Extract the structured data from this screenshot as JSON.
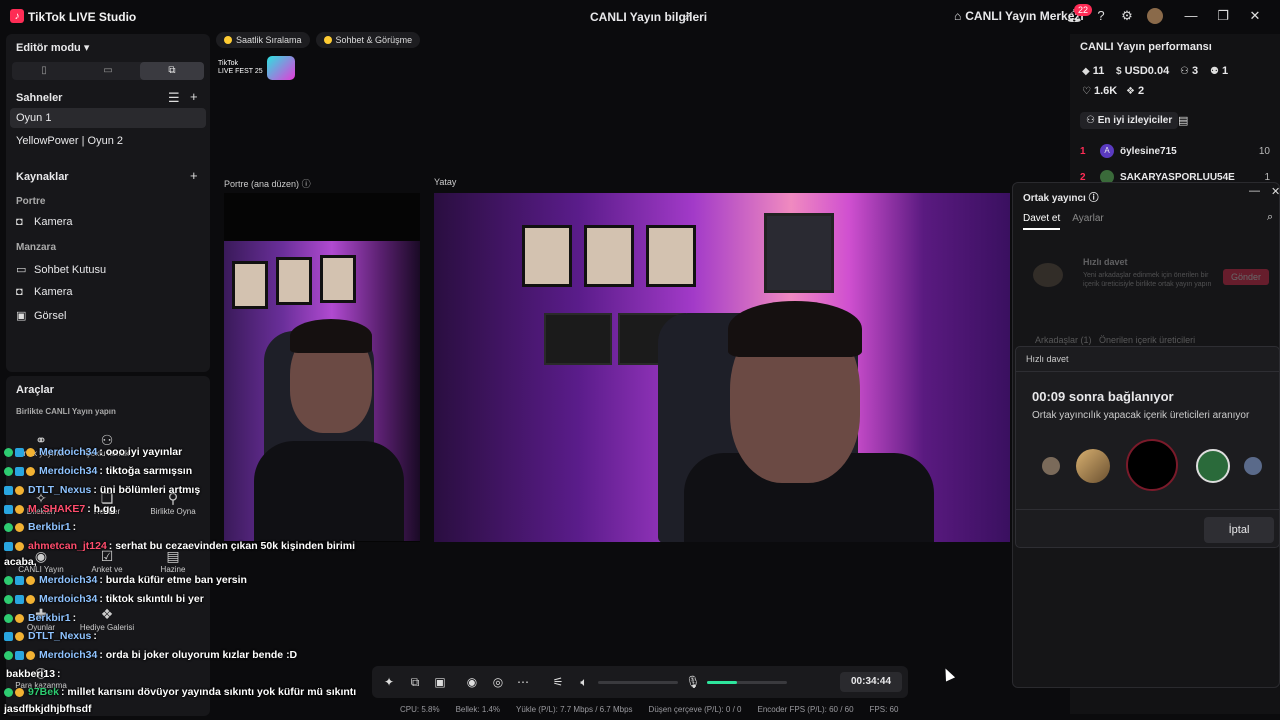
{
  "titlebar": {
    "app_name": "TikTok LIVE Studio",
    "center_title": "CANLI Yayın bilgileri",
    "live_center": "CANLI Yayın Merkezi",
    "notification_count": "22"
  },
  "left": {
    "editor_mode": "Editör modu",
    "scenes_title": "Sahneler",
    "scenes": [
      "Oyun 1",
      "YellowPower | Oyun 2"
    ],
    "sources_title": "Kaynaklar",
    "group_portrait": "Portre",
    "portrait_sources": [
      "Kamera"
    ],
    "group_landscape": "Manzara",
    "landscape_sources": [
      "Sohbet Kutusu",
      "Kamera",
      "Görsel"
    ],
    "tools_title": "Araçlar",
    "tools_sub": "Birlikte CANLI Yayın yapın",
    "tools": [
      "Ortak yayıncı",
      "Çoklu konuk",
      "Dilekleri",
      "Rehber",
      "Birlikte Oyna",
      "CANLI Yayın",
      "Anket ve",
      "Hazine",
      "Oyunlar",
      "Hediye Galerisi",
      "Para kazanma"
    ]
  },
  "top": {
    "pill_1": "Saatlik Sıralama",
    "pill_2": "Sohbet & Görüşme",
    "fest_line1": "TikTok",
    "fest_line2": "LIVE FEST 25",
    "portrait_label": "Portre (ana düzen)",
    "landscape_label": "Yatay"
  },
  "right": {
    "title": "CANLI Yayın performansı",
    "stats": {
      "diamonds": "11",
      "usd": "USD0.04",
      "viewers": "3",
      "followers": "1",
      "likes": "1.6K",
      "gifts": "2"
    },
    "top_viewers_btn": "En iyi izleyiciler",
    "ranking": [
      {
        "rank": "1",
        "initial": "A",
        "name": "öylesine715",
        "value": "10"
      },
      {
        "rank": "2",
        "initial": "",
        "name": "SAKARYASPORLUU54E",
        "value": "1"
      }
    ]
  },
  "cohost": {
    "title": "Ortak yayıncı",
    "tab_invite": "Davet et",
    "tab_settings": "Ayarlar",
    "quick_title": "Hızlı davet",
    "quick_desc": "Yeni arkadaşlar edinmek için önerilen bir içerik üreticisiyle birlikte ortak yayın yapın",
    "send_btn": "Gönder",
    "friends": "Arkadaşlar (1)",
    "suggested": "Önerilen içerik üreticileri"
  },
  "modal": {
    "title": "Hızlı davet",
    "heading": "00:09 sonra bağlanıyor",
    "subtitle": "Ortak yayıncılık yapacak içerik üreticileri aranıyor",
    "cancel": "İptal"
  },
  "chat": [
    {
      "nick": "Merdoich34",
      "msg": ": ooo iyi yayınlar",
      "color": "#8fc3ff"
    },
    {
      "nick": "Merdoich34",
      "msg": ": tiktoğa sarmışsın",
      "color": "#8fc3ff"
    },
    {
      "nick": "DTLT_Nexus",
      "msg": ": üni bölümleri artmış",
      "color": "#8fc3ff"
    },
    {
      "nick": "M_SHAKE7",
      "msg": ": h.gg",
      "color": "#ff4d6d"
    },
    {
      "nick": "Berkbir1",
      "msg": ":",
      "color": "#8fc3ff"
    },
    {
      "nick": "ahmetcan_jt124",
      "msg": ": serhat bu cezaevinden çıkan 50k kişinden birimi",
      "color": "#ff4d6d"
    },
    {
      "nick": "",
      "msg": "acaba,",
      "color": "#ffffff"
    },
    {
      "nick": "Merdoich34",
      "msg": ": burda küfür etme ban yersin",
      "color": "#8fc3ff"
    },
    {
      "nick": "Merdoich34",
      "msg": ": tiktok sıkıntılı bi yer",
      "color": "#8fc3ff"
    },
    {
      "nick": "Berkbir1",
      "msg": ":",
      "color": "#8fc3ff"
    },
    {
      "nick": "DTLT_Nexus",
      "msg": ":",
      "color": "#8fc3ff"
    },
    {
      "nick": "Merdoich34",
      "msg": ": orda bi joker oluyorum kızlar bende :D",
      "color": "#8fc3ff"
    },
    {
      "nick": "bakberi13",
      "msg": ":",
      "color": "#ffffff"
    },
    {
      "nick": "97Bek",
      "msg": ": millet karısını dövüyor yayında sıkıntı yok küfür mü sıkıntı",
      "color": "#2ecc71"
    },
    {
      "nick": "",
      "msg": "jasdfbkjdhjbfhsdf",
      "color": "#ffffff"
    }
  ],
  "controls": {
    "timer": "00:34:44",
    "volume_level": 0,
    "mic_level": 0.38
  },
  "status": {
    "cpu": "CPU: 5.8%",
    "memory": "Bellek: 1.4%",
    "upload": "Yükle (P/L): 7.7 Mbps / 6.7 Mbps",
    "dropped": "Düşen çerçeve (P/L): 0 / 0",
    "encoder_fps": "Encoder FPS (P/L): 60 / 60",
    "fps": "FPS: 60"
  }
}
